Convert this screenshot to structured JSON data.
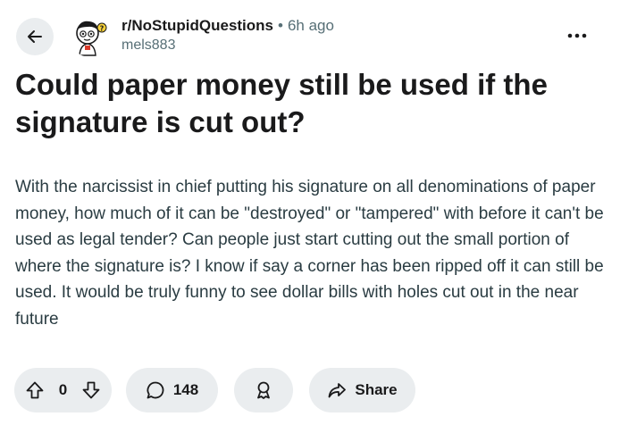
{
  "header": {
    "subreddit": "r/NoStupidQuestions",
    "separator": "•",
    "time_ago": "6h ago",
    "username": "mels883"
  },
  "post": {
    "title": "Could paper money still be used if the signature is cut out?",
    "body": "With the narcissist in chief putting his signature on all denominations of paper money, how much of it can be \"destroyed\" or \"tampered\" with before it can't be used as legal tender? Can people just start cutting out the small portion of where the signature is? I know if say a corner has been ripped off it can still be used. It would be truly funny to see dollar bills with holes cut out in the near future"
  },
  "actions": {
    "vote_count": "0",
    "comment_count": "148",
    "share_label": "Share"
  },
  "icons": {
    "back": "arrow-left-icon",
    "more": "more-horizontal-icon",
    "upvote": "arrow-up-icon",
    "downvote": "arrow-down-icon",
    "comment": "comment-bubble-icon",
    "award": "award-icon",
    "share": "share-arrow-icon"
  },
  "colors": {
    "pill_background": "#eaedef",
    "secondary_text": "#576f76",
    "body_text": "#2a3c42"
  }
}
